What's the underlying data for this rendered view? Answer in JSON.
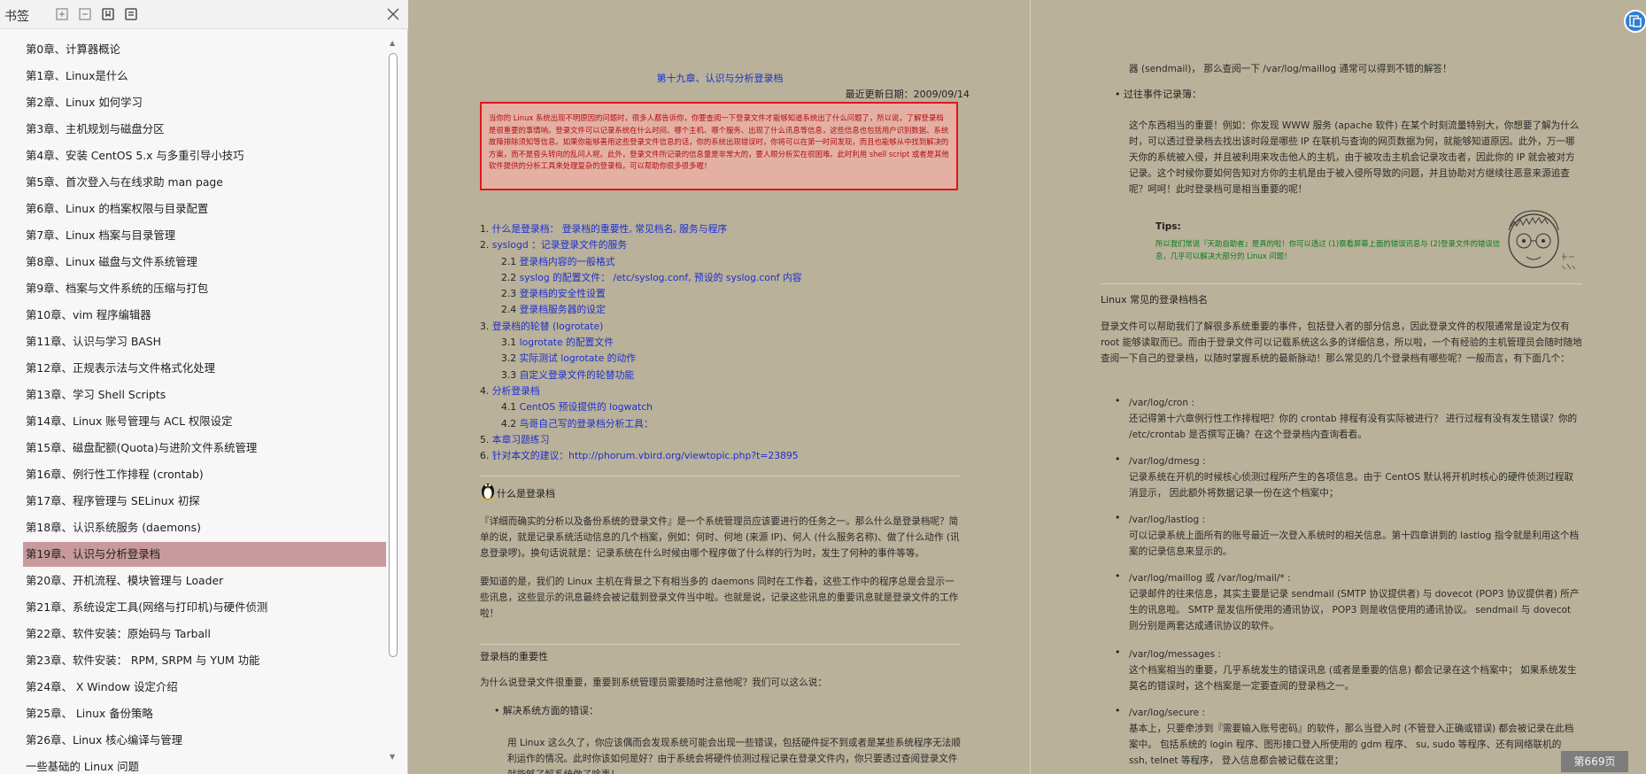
{
  "panel": {
    "title": "书签",
    "items": [
      "第0章、计算器概论",
      "第1章、Linux是什么",
      "第2章、Linux 如何学习",
      "第3章、主机规划与磁盘分区",
      "第4章、安装 CentOS 5.x 与多重引导小技巧",
      "第5章、首次登入与在线求助 man page",
      "第6章、Linux 的档案权限与目录配置",
      "第7章、Linux 档案与目录管理",
      "第8章、Linux 磁盘与文件系统管理",
      "第9章、档案与文件系统的压缩与打包",
      "第10章、vim 程序编辑器",
      "第11章、认识与学习 BASH",
      "第12章、正规表示法与文件格式化处理",
      "第13章、学习 Shell Scripts",
      "第14章、Linux 账号管理与 ACL 权限设定",
      "第15章、磁盘配额(Quota)与进阶文件系统管理",
      "第16章、例行性工作排程 (crontab)",
      "第17章、程序管理与 SELinux 初探",
      "第18章、认识系统服务 (daemons)",
      "第19章、认识与分析登录档",
      "第20章、开机流程、模块管理与 Loader",
      "第21章、系统设定工具(网络与打印机)与硬件侦测",
      "第22章、软件安装：原始码与 Tarball",
      "第23章、软件安装： RPM, SRPM 与 YUM 功能",
      "第24章、 X Window 设定介绍",
      "第25章、 Linux 备份策略",
      "第26章、Linux 核心编译与管理",
      "一些基础的 Linux 问题"
    ],
    "active_index": 19
  },
  "left_page": {
    "chapter_title": "第十九章、认识与分析登录档",
    "date": "最近更新日期：2009/09/14",
    "intro": "当你的 Linux 系统出现不明原因的问题时，很多人都告诉你，你要查阅一下登录文件才能够知道系统出了什么问题了，所以说，了解登录档是很重要的事情呐。登录文件可以记录系统在什么时间、哪个主机、哪个服务、出现了什么讯息等信息，这些信息也包括用户识别数据、系统故障排除须知等信息。如果你能够善用这些登录文件信息的话，你的系统出现错误时，你将可以在第一时间发现，而且也能够从中找到解决的方案，而不是昏头转向的乱问人呢。此外，登录文件所记录的信息量是非常大的，要人眼分析实在很困难。此时利用 shell script 或者是其他软件提供的分析工具来处理复杂的登录档，可以帮助你很多很多喔！",
    "toc": [
      {
        "num": "1. ",
        "text": "什么是登录档： 登录档的重要性, 常见档名, 服务与程序",
        "sub": false
      },
      {
        "num": "2. ",
        "text": "syslogd ：记录登录文件的服务",
        "sub": false
      },
      {
        "num": "2.1 ",
        "text": "登录档内容的一般格式",
        "sub": true
      },
      {
        "num": "2.2 ",
        "text": "syslog 的配置文件： /etc/syslog.conf, 预设的 syslog.conf 内容",
        "sub": true
      },
      {
        "num": "2.3 ",
        "text": "登录档的安全性设置",
        "sub": true
      },
      {
        "num": "2.4 ",
        "text": "登录档服务器的设定",
        "sub": true
      },
      {
        "num": "3. ",
        "text": "登录档的轮替 (logrotate)",
        "sub": false
      },
      {
        "num": "3.1 ",
        "text": "logrotate 的配置文件",
        "sub": true
      },
      {
        "num": "3.2 ",
        "text": "实际测试 logrotate 的动作",
        "sub": true
      },
      {
        "num": "3.3 ",
        "text": "自定义登录文件的轮替功能",
        "sub": true
      },
      {
        "num": "4. ",
        "text": "分析登录档",
        "sub": false
      },
      {
        "num": "4.1 ",
        "text": "CentOS 预设提供的 logwatch",
        "sub": true
      },
      {
        "num": "4.2 ",
        "text": "鸟哥自己写的登录档分析工具：",
        "sub": true
      },
      {
        "num": "5. ",
        "text": "本章习题练习",
        "sub": false
      },
      {
        "num": "6. ",
        "text": "针对本文的建议：http://phorum.vbird.org/viewtopic.php?t=23895",
        "sub": false
      }
    ],
    "section_heading": "什么是登录档",
    "para1": "『详细而确实的分析以及备份系统的登录文件』是一个系统管理员应该要进行的任务之一。那么什么是登录档呢？简单的说，就是记录系统活动信息的几个档案，例如：何时、何地 (来源 IP)、何人 (什么服务名称)、做了什么动作 (讯息登录啰)。换句话说就是：记录系统在什么时候由哪个程序做了什么样的行为时，发生了何种的事件等等。",
    "para2": "要知道的是，我们的 Linux 主机在背景之下有相当多的 daemons 同时在工作着，这些工作中的程序总是会显示一些讯息，这些显示的讯息最终会被记载到登录文件当中啦。也就是说，记录这些讯息的重要讯息就是登录文件的工作啦！",
    "subheading": "登录档的重要性",
    "para3": "为什么说登录文件很重要，重要到系统管理员需要随时注意他呢？我们可以这么说：",
    "bullet1": "解决系统方面的错误：",
    "para4": "用 Linux 这么久了，你应该偶而会发现系统可能会出现一些错误，包括硬件捉不到或者是某些系统程序无法顺利运作的情况。此时你该如何是好？由于系统会将硬件侦测过程记录在登录文件内，你只要透过查阅登录文件就能够了解系统做了啥事！"
  },
  "right_page": {
    "top_line": "器 (sendmail)， 那么查阅一下 /var/log/maillog 通常可以得到不错的解答！",
    "bullet1": "过往事件记录簿：",
    "para1": "这个东西相当的重要！例如：你发现 WWW 服务 (apache 软件) 在某个时刻流量特别大，你想要了解为什么时，可以透过登录档去找出该时段是哪些 IP 在联机与查询的网页数据为何，就能够知道原因。此外，万一哪天你的系统被入侵，并且被利用来攻击他人的主机，由于被攻击主机会记录攻击者，因此你的 IP 就会被对方记录。这个时候你要如何告知对方你的主机是由于被入侵所导致的问题，并且协助对方继续往恶意来源追查呢？呵呵！此时登录档可是相当重要的呢！",
    "tips_title": "Tips:",
    "tips_text": "所以我们常说『天助自助者』是真的啦！你可以透过 (1)察看屏幕上面的错误讯息与 (2)登录文件的错误信息，几乎可以解决大部分的 Linux 问题！",
    "section_heading": "Linux 常见的登录档档名",
    "para2": "登录文件可以帮助我们了解很多系统重要的事件，包括登入者的部分信息，因此登录文件的权限通常是设定为仅有 root 能够读取而已。而由于登录文件可以记载系统这么多的详细信息，所以啦，一个有经验的主机管理员会随时随地查阅一下自己的登录档，以随时掌握系统的最新脉动！那么常见的几个登录档有哪些呢？一般而言，有下面几个：",
    "items": [
      {
        "name": "/var/log/cron :",
        "desc": "还记得第十六章例行性工作排程吧？你的 crontab 排程有没有实际被进行？ 进行过程有没有发生错误？你的 /etc/crontab 是否撰写正确？在这个登录档内查询看看。"
      },
      {
        "name": "/var/log/dmesg :",
        "desc": "记录系统在开机的时候核心侦测过程所产生的各项信息。由于 CentOS 默认将开机时核心的硬件侦测过程取消显示， 因此额外将数据记录一份在这个档案中；"
      },
      {
        "name": "/var/log/lastlog :",
        "desc": "可以记录系统上面所有的账号最近一次登入系统时的相关信息。第十四章讲到的 lastlog 指令就是利用这个档案的记录信息来显示的。"
      },
      {
        "name": "/var/log/maillog 或 /var/log/mail/* :",
        "desc": "记录邮件的往来信息，其实主要是记录 sendmail (SMTP 协议提供者) 与 dovecot (POP3 协议提供者) 所产生的讯息啦。 SMTP 是发信所使用的通讯协议， POP3 则是收信使用的通讯协议。 sendmail 与 dovecot 则分别是两套达成通讯协议的软件。"
      },
      {
        "name": "/var/log/messages :",
        "desc": "这个档案相当的重要，几乎系统发生的错误讯息 (或者是重要的信息) 都会记录在这个档案中； 如果系统发生莫名的错误时，这个档案是一定要查阅的登录档之一。"
      },
      {
        "name": "/var/log/secure :",
        "desc": "基本上，只要牵涉到『需要输入账号密码』的软件，那么当登入时 (不管登入正确或错误) 都会被记录在此档案中。 包括系统的 login 程序、图形接口登入所使用的 gdm 程序、 su, sudo 等程序、还有网络联机的 ssh, telnet 等程序， 登入信息都会被记载在这里；"
      }
    ]
  },
  "page_indicator": "第669页",
  "colors": {
    "page_bg": "#b9b199",
    "link": "#1d2fd0",
    "active_bookmark": "#c99a9d",
    "intro_border": "#e0161c",
    "tips_text": "#0b7b1d"
  },
  "icons": [
    "expand-all-icon",
    "collapse-all-icon",
    "add-bookmark-icon",
    "bookmark-options-icon",
    "close-icon",
    "penguin-icon",
    "cartoon-face-icon",
    "reader-tool-icon"
  ]
}
